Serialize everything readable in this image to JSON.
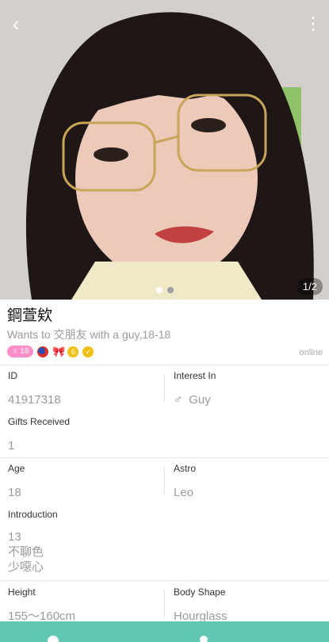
{
  "photo": {
    "back_icon": "chevron-left-icon",
    "more_icon": "more-vertical-icon",
    "counter": "1/2",
    "page_count": 2,
    "active_page": 1
  },
  "profile": {
    "name": "鋼萱欸",
    "wants": "Wants to 交朋友 with a guy,18-18",
    "age_badge": "♀ 18",
    "status": "online"
  },
  "fields": {
    "id": {
      "label": "ID",
      "value": "41917318"
    },
    "interest": {
      "label": "Interest In",
      "symbol": "♂",
      "value": "Guy"
    },
    "gifts": {
      "label": "Gifts Received",
      "value": "1"
    },
    "age": {
      "label": "Age",
      "value": "18"
    },
    "astro": {
      "label": "Astro",
      "value": "Leo"
    },
    "intro": {
      "label": "Introduction",
      "line1": "13",
      "line2": "不聊色",
      "line3": "少噁心"
    },
    "height": {
      "label": "Height",
      "value": "155～160cm"
    },
    "body_shape": {
      "label": "Body Shape",
      "value": "Hourglass"
    }
  },
  "colors": {
    "accent": "#62c7b3",
    "age_badge": "#ff8fc8",
    "muted_text": "#9a9a9a"
  }
}
